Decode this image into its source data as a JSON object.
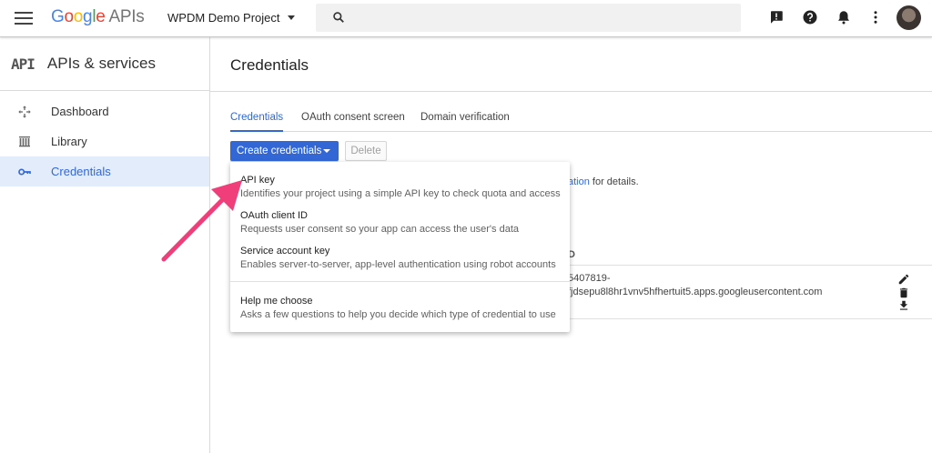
{
  "topbar": {
    "logo_letters": [
      "G",
      "o",
      "o",
      "g",
      "l",
      "e"
    ],
    "logo_suffix": "APIs",
    "project_name": "WPDM Demo Project",
    "search_placeholder": "",
    "icons": [
      "menu-icon",
      "search-icon",
      "feedback-icon",
      "help-icon",
      "notifications-icon",
      "more-vert-icon",
      "avatar"
    ]
  },
  "sidebar": {
    "mark": "API",
    "title": "APIs & services",
    "items": [
      {
        "label": "Dashboard",
        "icon": "dashboard-icon",
        "active": false
      },
      {
        "label": "Library",
        "icon": "library-icon",
        "active": false
      },
      {
        "label": "Credentials",
        "icon": "key-icon",
        "active": true
      }
    ]
  },
  "main": {
    "title": "Credentials",
    "tabs": [
      {
        "label": "Credentials",
        "active": true
      },
      {
        "label": "OAuth consent screen",
        "active": false
      },
      {
        "label": "Domain verification",
        "active": false
      }
    ],
    "create_button": "Create credentials",
    "delete_button": "Delete",
    "partial_link": "ation",
    "partial_text": " for details.",
    "partial_header": "D",
    "client_id_line1": "5407819-",
    "client_id_line2": "fjdsepu8l8hr1vnv5hfhertuit5.apps.googleusercontent.com"
  },
  "menu": {
    "items": [
      {
        "title": "API key",
        "desc": "Identifies your project using a simple API key to check quota and access"
      },
      {
        "title": "OAuth client ID",
        "desc": "Requests user consent so your app can access the user's data"
      },
      {
        "title": "Service account key",
        "desc": "Enables server-to-server, app-level authentication using robot accounts"
      },
      {
        "title": "Help me choose",
        "desc": "Asks a few questions to help you decide which type of credential to use"
      }
    ]
  },
  "colors": {
    "accent": "#3367d6",
    "active_bg": "#e3ecfa",
    "arrow": "#f03e7a"
  }
}
